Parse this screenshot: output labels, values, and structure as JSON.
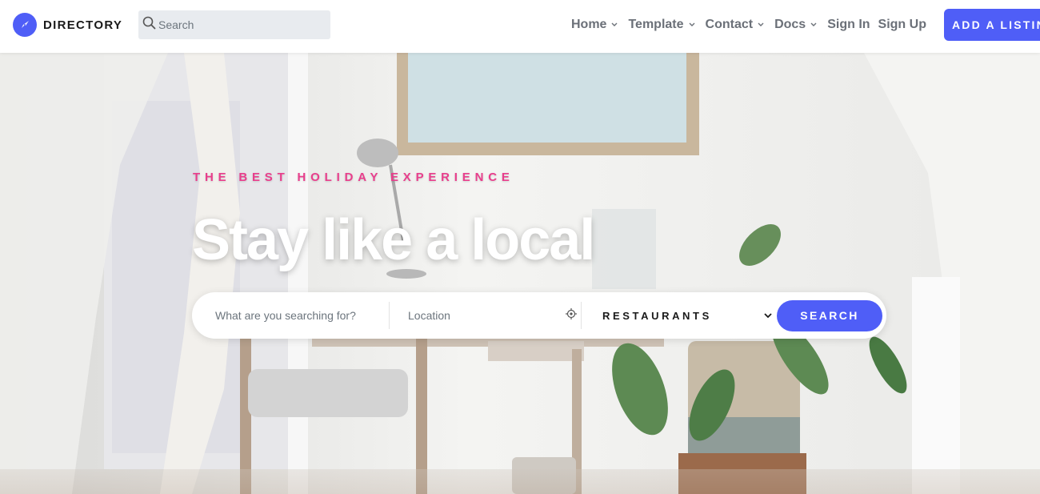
{
  "brand": {
    "name": "DIRECTORY",
    "icon": "compass-icon",
    "color": "#4f5ef7"
  },
  "header_search": {
    "placeholder": "Search",
    "icon": "search-icon"
  },
  "nav": {
    "items": [
      {
        "label": "Home",
        "has_dropdown": true
      },
      {
        "label": "Template",
        "has_dropdown": true
      },
      {
        "label": "Contact",
        "has_dropdown": true
      },
      {
        "label": "Docs",
        "has_dropdown": true
      },
      {
        "label": "Sign In",
        "has_dropdown": false
      },
      {
        "label": "Sign Up",
        "has_dropdown": false
      }
    ],
    "cta_label": "ADD A LISTING"
  },
  "hero": {
    "kicker": "THE BEST HOLIDAY EXPERIENCE",
    "headline": "Stay like a local",
    "search": {
      "what_placeholder": "What are you searching for?",
      "location_placeholder": "Location",
      "location_icon": "crosshair-icon",
      "category_value": "RESTAURANTS",
      "button_label": "SEARCH"
    }
  },
  "colors": {
    "accent": "#4f5ef7",
    "kicker": "#e83e8c",
    "nav_text": "#6b7078"
  }
}
